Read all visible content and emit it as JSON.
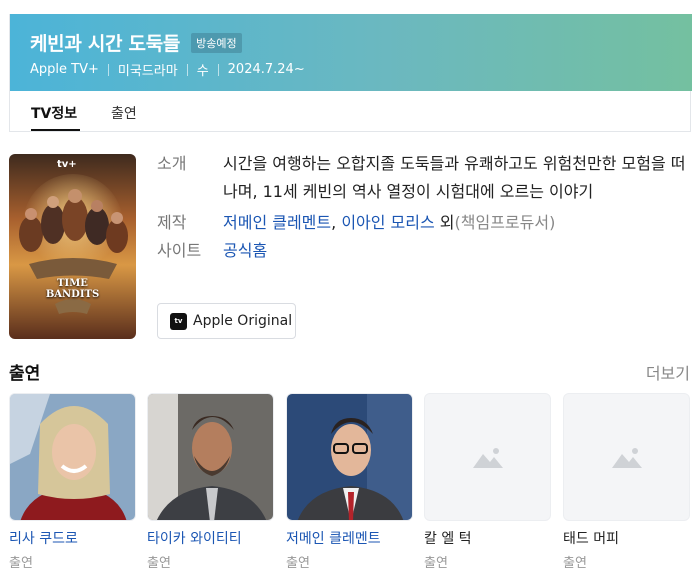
{
  "header": {
    "title": "케빈과 시간 도둑들",
    "badge": "방송예정",
    "meta": [
      "Apple TV+",
      "미국드라마",
      "수",
      "2024.7.24~"
    ]
  },
  "tabs": [
    {
      "label": "TV정보",
      "active": true
    },
    {
      "label": "출연",
      "active": false
    }
  ],
  "poster": {
    "brand": "tv+",
    "title_line1": "TIME",
    "title_line2": "BANDITS"
  },
  "info": {
    "intro_label": "소개",
    "intro_text": "시간을 여행하는 오합지졸 도둑들과 유쾌하고도 위험천만한 모험을 떠나며, 11세 케빈의 역사 열정이 시험대에 오르는 이야기",
    "production_label": "제작",
    "production_person1": "저메인 클레멘트",
    "production_sep": ", ",
    "production_person2": "이아인 모리스",
    "production_suffix": " 외",
    "production_role": "(책임프로듀서)",
    "site_label": "사이트",
    "site_link": "공식홈"
  },
  "apple_button": {
    "label": "Apple Original",
    "icon_text": "tv"
  },
  "cast_section": {
    "title": "출연",
    "more": "더보기",
    "members": [
      {
        "name": "리사 쿠드로",
        "role": "출연",
        "linked": true
      },
      {
        "name": "타이카 와이티티",
        "role": "출연",
        "linked": true
      },
      {
        "name": "저메인 클레멘트",
        "role": "출연",
        "linked": true
      },
      {
        "name": "칼 엘 턱",
        "role": "출연",
        "linked": false
      },
      {
        "name": "태드 머피",
        "role": "출연",
        "linked": false
      }
    ]
  },
  "colors": {
    "link": "#1b56b3",
    "header_start": "#4cb4d8",
    "header_end": "#74c0a0"
  }
}
